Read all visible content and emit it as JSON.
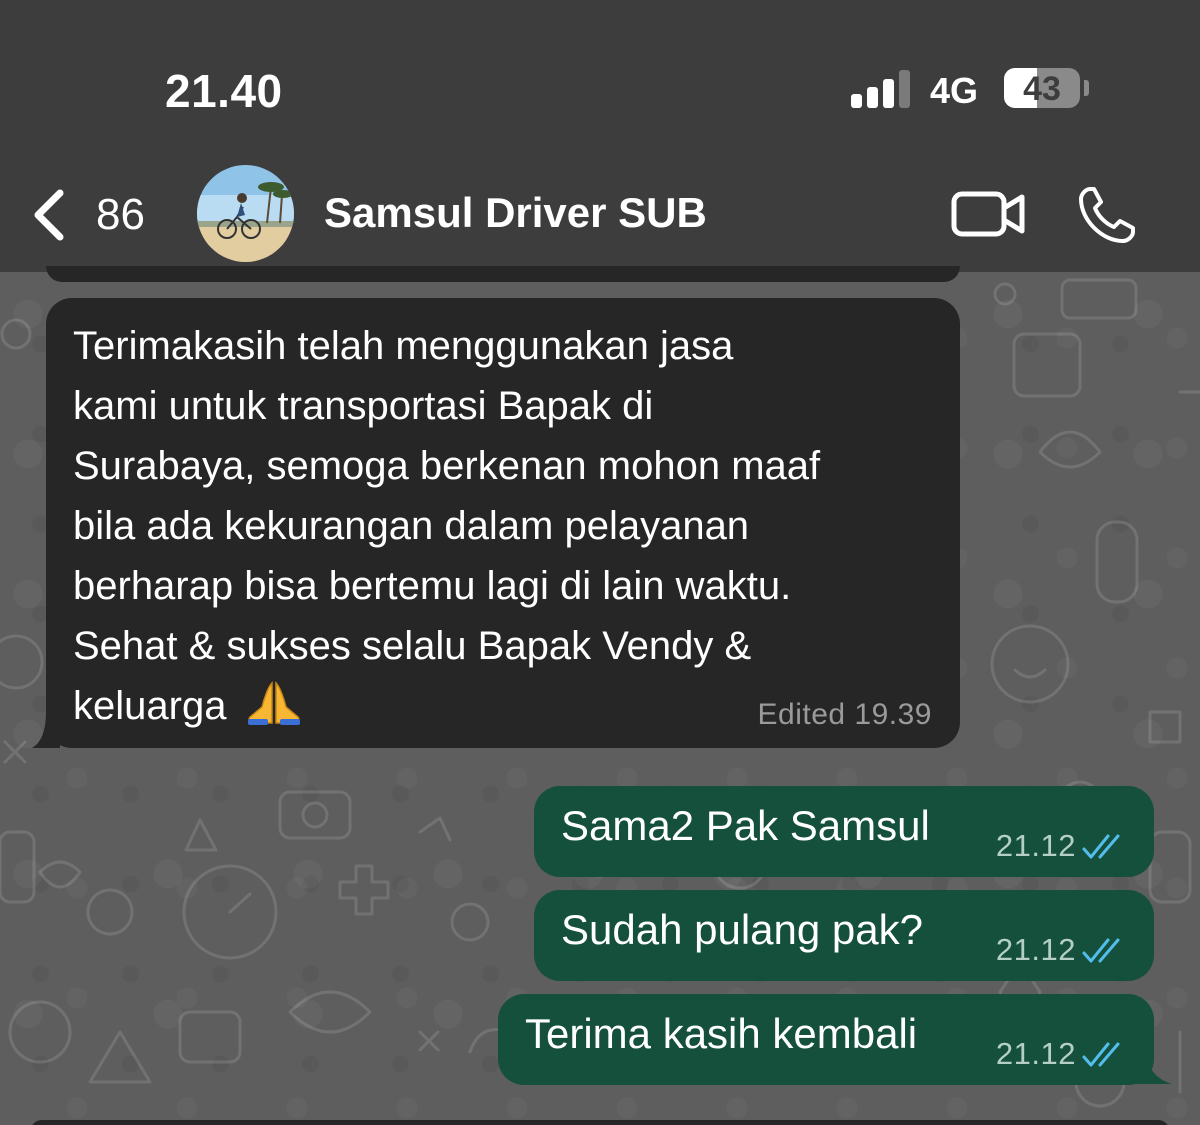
{
  "status_bar": {
    "time": "21.40",
    "network": "4G",
    "battery": "43",
    "battery_level_percent": 43,
    "signal_bars_active": 3,
    "signal_bars_total": 4
  },
  "header": {
    "back_count": "86",
    "contact_name": "Samsul Driver SUB",
    "icons": [
      "chevron-left-icon",
      "video-call-icon",
      "phone-icon"
    ]
  },
  "messages": {
    "incoming": {
      "lines": [
        "Terimakasih telah menggunakan jasa",
        "kami untuk transportasi Bapak di",
        "Surabaya, semoga berkenan mohon maaf",
        "bila ada kekurangan dalam pelayanan",
        "berharap bisa bertemu lagi di lain waktu.",
        "Sehat & sukses selalu Bapak Vendy &",
        "keluarga"
      ],
      "emoji": "folded-hands",
      "meta": "Edited 19.39"
    },
    "outgoing": [
      {
        "text": "Sama2 Pak Samsul",
        "time": "21.12",
        "status": "read"
      },
      {
        "text": "Sudah pulang pak?",
        "time": "21.12",
        "status": "read"
      },
      {
        "text": "Terima kasih kembali",
        "time": "21.12",
        "status": "read"
      }
    ]
  },
  "colors": {
    "header_bg": "#3d3d3d",
    "incoming_bubble": "#262626",
    "outgoing_bubble": "#14503c",
    "read_ticks": "#53bdeb",
    "wallpaper": "#5e5e5e"
  }
}
